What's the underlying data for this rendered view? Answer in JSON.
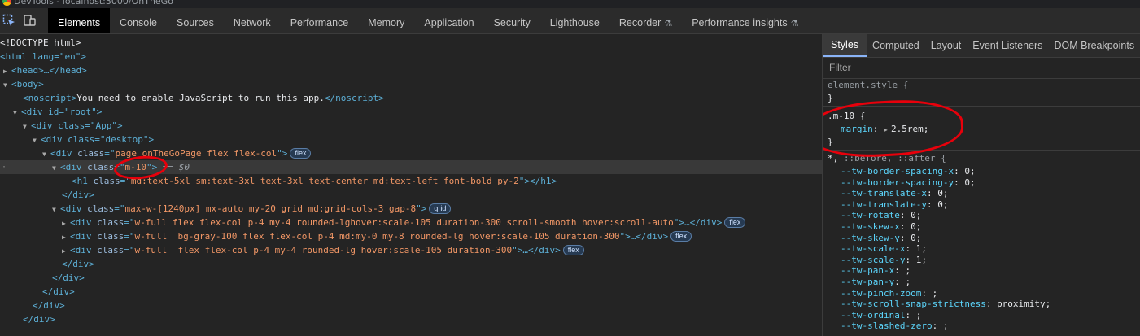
{
  "window": {
    "title": "DevTools - localhost:3000/OnTheGo"
  },
  "main_tabs": [
    {
      "label": "Elements",
      "active": true
    },
    {
      "label": "Console"
    },
    {
      "label": "Sources"
    },
    {
      "label": "Network"
    },
    {
      "label": "Performance"
    },
    {
      "label": "Memory"
    },
    {
      "label": "Application"
    },
    {
      "label": "Security"
    },
    {
      "label": "Lighthouse"
    },
    {
      "label": "Recorder",
      "experimental": true
    },
    {
      "label": "Performance insights",
      "experimental": true
    }
  ],
  "dom": {
    "doctype": "<!DOCTYPE html>",
    "html_open": "<html lang=\"en\">",
    "head": "<head>…</head>",
    "body": "<body>",
    "noscript_tag_open": "<noscript>",
    "noscript_text": "You need to enable JavaScript to run this app.",
    "noscript_tag_close": "</noscript>",
    "root": "<div id=\"root\">",
    "app": "<div class=\"App\">",
    "desktop": "<div class=\"desktop\">",
    "page_class": "page onTheGoPage flex flex-col",
    "m10_class": "m-10",
    "selected_marker": "== $0",
    "h1_class": "md:text-5xl sm:text-3xl text-3xl text-center md:text-left font-bold py-2",
    "grid_class": "max-w-[1240px] mx-auto my-20 grid md:grid-cols-3 gap-8",
    "card1_class": "w-full flex flex-col p-4 my-4 rounded-lghover:scale-105 duration-300 scroll-smooth hover:scroll-auto",
    "card2_class": "w-full  bg-gray-100 flex flex-col p-4 md:my-0 my-8 rounded-lg hover:scale-105 duration-300",
    "card3_class": "w-full  flex flex-col p-4 my-4 rounded-lg hover:scale-105 duration-300",
    "close_div": "</div>",
    "badge_flex": "flex",
    "badge_grid": "grid"
  },
  "styles_tabs": [
    {
      "label": "Styles",
      "active": true
    },
    {
      "label": "Computed"
    },
    {
      "label": "Layout"
    },
    {
      "label": "Event Listeners"
    },
    {
      "label": "DOM Breakpoints"
    }
  ],
  "styles": {
    "filter_placeholder": "Filter",
    "element_style": "element.style {",
    "close_brace": "}",
    "m10_selector": ".m-10 {",
    "margin_name": "margin",
    "margin_value": "2.5rem;",
    "universal_selector": "*,",
    "universal_rest": "::before, ::after {",
    "tw_props": [
      {
        "name": "--tw-border-spacing-x",
        "value": "0;"
      },
      {
        "name": "--tw-border-spacing-y",
        "value": "0;"
      },
      {
        "name": "--tw-translate-x",
        "value": "0;"
      },
      {
        "name": "--tw-translate-y",
        "value": "0;"
      },
      {
        "name": "--tw-rotate",
        "value": "0;"
      },
      {
        "name": "--tw-skew-x",
        "value": "0;"
      },
      {
        "name": "--tw-skew-y",
        "value": "0;"
      },
      {
        "name": "--tw-scale-x",
        "value": "1;"
      },
      {
        "name": "--tw-scale-y",
        "value": "1;"
      },
      {
        "name": "--tw-pan-x",
        "value": ";"
      },
      {
        "name": "--tw-pan-y",
        "value": ";"
      },
      {
        "name": "--tw-pinch-zoom",
        "value": ";"
      },
      {
        "name": "--tw-scroll-snap-strictness",
        "value": "proximity;"
      },
      {
        "name": "--tw-ordinal",
        "value": ";"
      },
      {
        "name": "--tw-slashed-zero",
        "value": ";"
      }
    ]
  },
  "colors": {
    "annotation": "#e8000b",
    "accent": "#8ab4f8"
  }
}
